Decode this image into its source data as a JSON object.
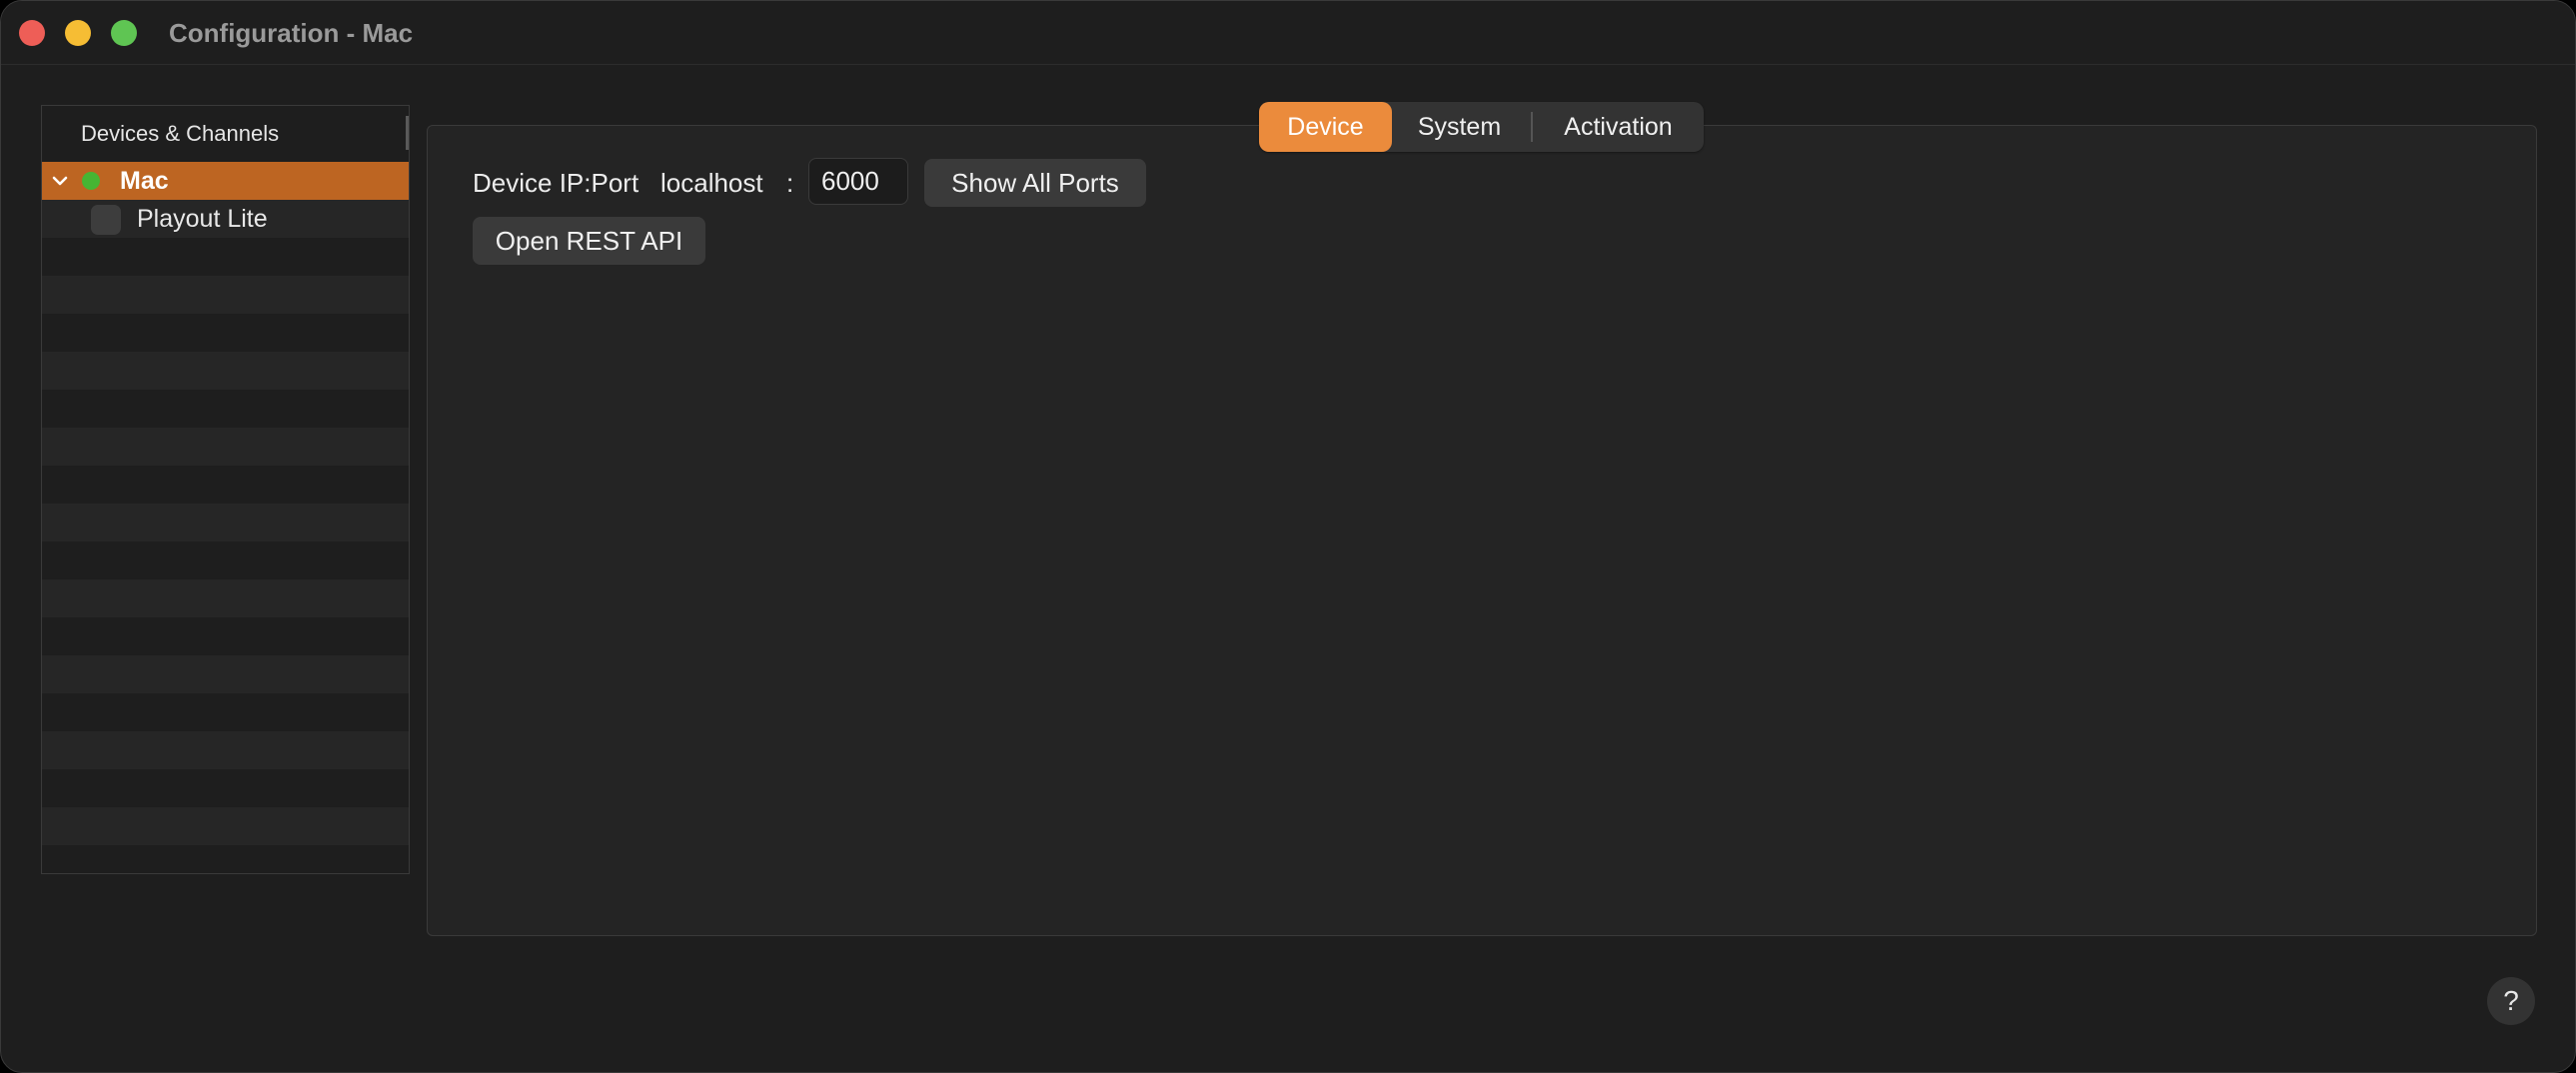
{
  "window": {
    "title": "Configuration - Mac"
  },
  "sidebar": {
    "header": "Devices & Channels",
    "device": {
      "label": "Mac",
      "status_color": "#46b533"
    },
    "channels": [
      {
        "label": "Playout Lite"
      }
    ]
  },
  "tabs": [
    {
      "label": "Device",
      "active": true
    },
    {
      "label": "System",
      "active": false
    },
    {
      "label": "Activation",
      "active": false
    }
  ],
  "device_panel": {
    "ip_port_label": "Device IP:Port",
    "host": "localhost",
    "separator": ":",
    "port": "6000",
    "show_ports_label": "Show All Ports",
    "open_rest_label": "Open REST API"
  },
  "help_label": "?",
  "colors": {
    "accent": "#eb8b3c",
    "selection": "#bd6522",
    "background": "#1e1e1e"
  }
}
